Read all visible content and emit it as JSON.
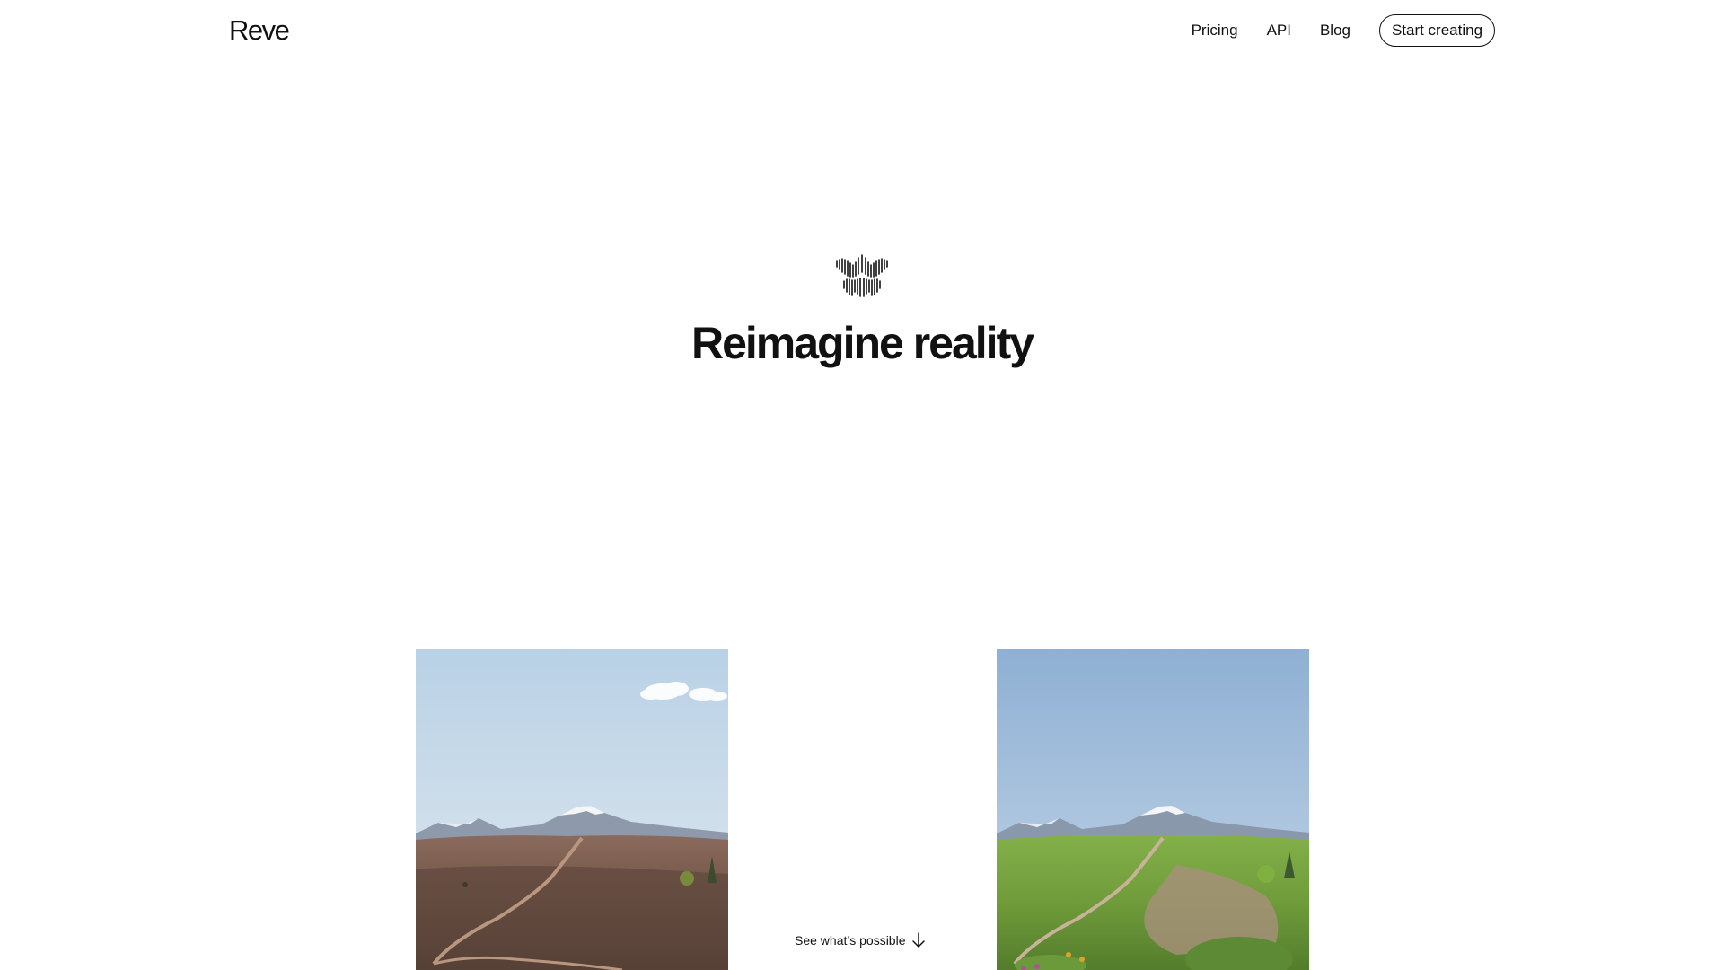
{
  "header": {
    "brand": "Reve",
    "nav": [
      {
        "label": "Pricing"
      },
      {
        "label": "API"
      },
      {
        "label": "Blog"
      }
    ],
    "cta_label": "Start creating"
  },
  "hero": {
    "logo_icon": "reve-butterfly-logo-icon",
    "title": "Reimagine reality"
  },
  "gallery": {
    "before_image": "volcanic-landscape-photo",
    "after_image": "green-landscape-photo"
  },
  "scroll_prompt": {
    "label": "See what’s possible",
    "icon": "arrow-down-icon"
  },
  "colors": {
    "text": "#111111",
    "background": "#ffffff"
  }
}
